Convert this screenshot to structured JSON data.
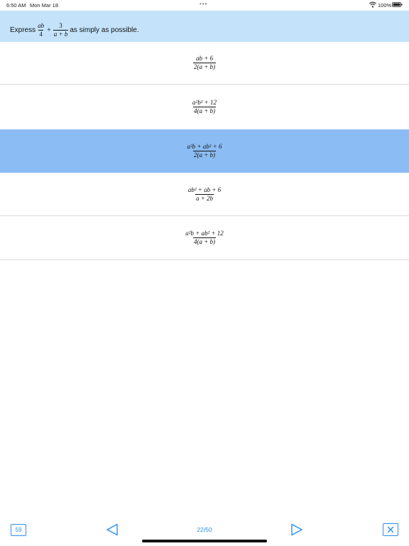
{
  "status_bar": {
    "time": "6:50 AM",
    "date": "Mon Mar 18",
    "dots": "•••",
    "battery": "100%"
  },
  "question": {
    "prefix": "Express",
    "frac1_num": "ab",
    "frac1_den": "4",
    "plus": "+",
    "frac2_num": "3",
    "frac2_den": "a + b",
    "suffix": "as simply as possible."
  },
  "choices": [
    {
      "num": "ab + 6",
      "den": "2(a + b)"
    },
    {
      "num": "a²b² + 12",
      "den": "4(a + b)"
    },
    {
      "num": "a²b + ab² + 6",
      "den": "2(a + b)"
    },
    {
      "num": "ab² + ab + 6",
      "den": "a + 2b"
    },
    {
      "num": "a²b + ab² + 12",
      "den": "4(a + b)"
    }
  ],
  "selected_choice": 2,
  "bottom_bar": {
    "question_number": "59",
    "page_counter": "22/50"
  },
  "colors": {
    "question_bg": "#c4e3fb",
    "selected_bg": "#8bbcf3",
    "accent": "#2a8ef0"
  }
}
